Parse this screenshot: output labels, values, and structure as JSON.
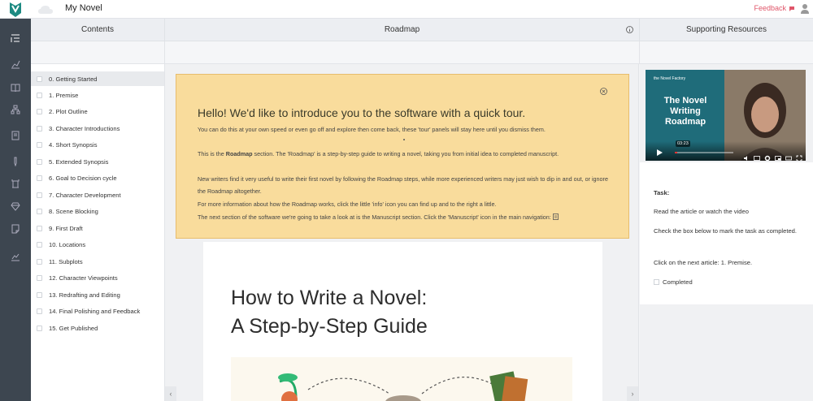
{
  "app": {
    "title": "My Novel",
    "feedback_label": "Feedback",
    "feedback_icon": "chat-bubble-icon"
  },
  "colors": {
    "nav_rail": "#3d4650",
    "logo": "#1d8a82",
    "tour_bg": "#f9dc9c",
    "feedback": "#e0566a"
  },
  "nav": {
    "icons": [
      "contents-icon",
      "chart-icon",
      "book-icon",
      "hierarchy-icon",
      "manuscript-icon",
      "pen-icon",
      "tower-icon",
      "gem-icon",
      "notes-icon",
      "stats-icon"
    ]
  },
  "columns": {
    "contents": "Contents",
    "roadmap": "Roadmap",
    "resources": "Supporting Resources"
  },
  "contents": {
    "items": [
      "0. Getting Started",
      "1. Premise",
      "2. Plot Outline",
      "3. Character Introductions",
      "4. Short Synopsis",
      "5. Extended Synopsis",
      "6. Goal to Decision cycle",
      "7. Character Development",
      "8. Scene Blocking",
      "9. First Draft",
      "10. Locations",
      "11. Subplots",
      "12. Character Viewpoints",
      "13. Redrafting and Editing",
      "14. Final Polishing and Feedback",
      "15. Get Published"
    ]
  },
  "tour": {
    "title": "Hello! We'd like to introduce you to the software with a quick tour.",
    "p1": "You can do this at your own speed or even go off and explore then come back, these 'tour' panels will stay here until you dismiss them.",
    "p2_a": "This is the ",
    "p2_b": "Roadmap",
    "p2_c": " section. The 'Roadmap' is a step-by-step guide to writing a novel, taking you from initial idea to completed manuscript.",
    "p3": "New writers find it very useful to write their first novel by following the Roadmap steps, while more experienced writers may just wish to dip in and out, or ignore the Roadmap altogether.",
    "p4": "For more information about how the Roadmap works, click the little 'info' icon you can find up and to the right a little.",
    "p5": "The next section of the software we're going to take a look at is the Manuscript section. Click the 'Manuscript' icon in the main navigation:"
  },
  "article": {
    "title_line1": "How to Write a Novel:",
    "title_line2": "A Step-by-Step Guide"
  },
  "video": {
    "brand": "the Novel Factory",
    "title": "The Novel Writing Roadmap",
    "time": "03:23",
    "progress": 0.04
  },
  "task": {
    "label": "Task:",
    "line1": "Read the article or watch the video",
    "line2": "Check the box below to mark the task as completed.",
    "line3": "Click on the next article: 1. Premise.",
    "checkbox_label": "Completed"
  }
}
